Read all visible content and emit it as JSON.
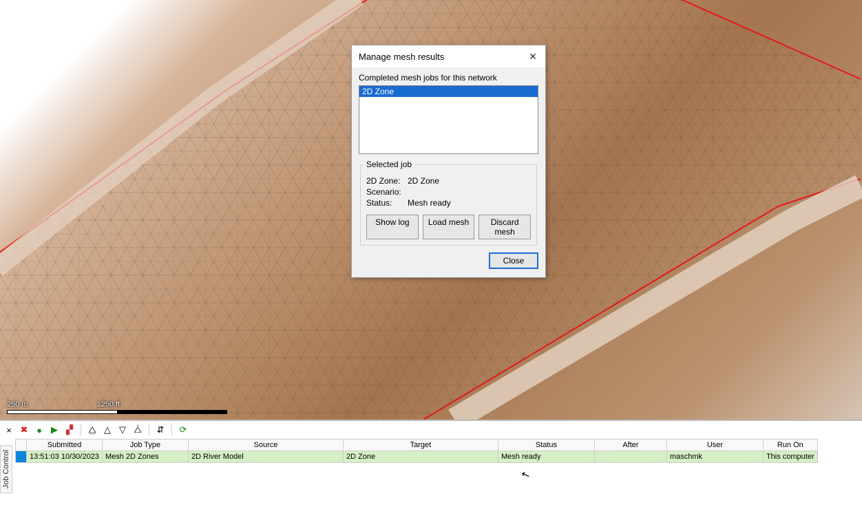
{
  "dialog": {
    "title": "Manage mesh results",
    "list_label": "Completed mesh jobs for this network",
    "list_items": [
      "2D Zone"
    ],
    "selected": {
      "legend": "Selected job",
      "zone_label": "2D Zone:",
      "zone_value": "2D Zone",
      "scenario_label": "Scenario:",
      "scenario_value": "",
      "status_label": "Status:",
      "status_value": "Mesh ready"
    },
    "buttons": {
      "show_log": "Show log",
      "load_mesh": "Load mesh",
      "discard_mesh": "Discard mesh",
      "close": "Close"
    }
  },
  "scale": {
    "left": "250 m",
    "right": "1250 ft"
  },
  "panel": {
    "tab": "Job Control",
    "columns": [
      "",
      "Submitted",
      "Job Type",
      "Source",
      "Target",
      "Status",
      "After",
      "User",
      "Run On"
    ],
    "row": {
      "submitted": "13:51:03 10/30/2023",
      "job_type": "Mesh 2D Zones",
      "source": "2D River Model",
      "target": "2D Zone",
      "status": "Mesh ready",
      "after": "",
      "user": "maschmk",
      "run_on": "This computer"
    }
  }
}
